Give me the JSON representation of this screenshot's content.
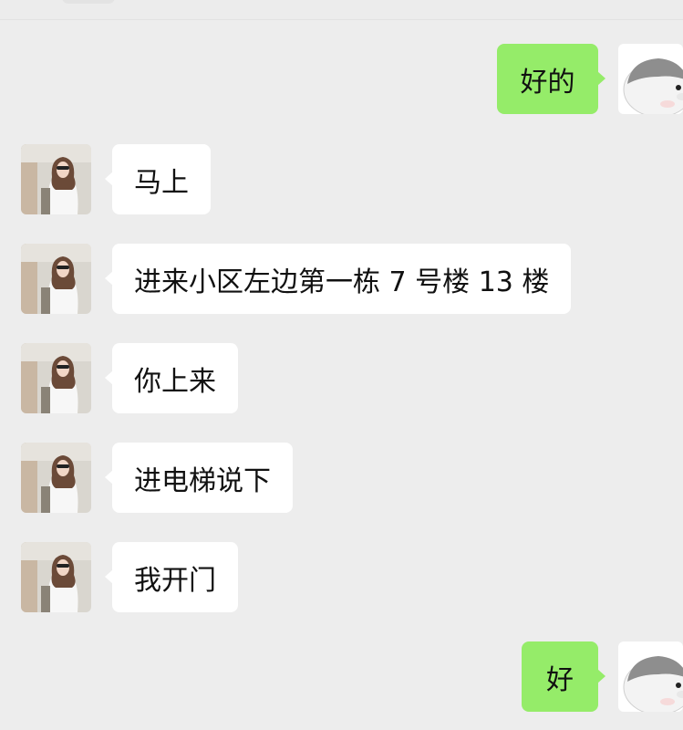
{
  "chat": {
    "messages": [
      {
        "side": "out",
        "text": "好的",
        "avatar": "hamster-icon"
      },
      {
        "side": "in",
        "text": "马上",
        "avatar": "contact-photo"
      },
      {
        "side": "in",
        "text": "进来小区左边第一栋 7 号楼 13 楼",
        "avatar": "contact-photo"
      },
      {
        "side": "in",
        "text": "你上来",
        "avatar": "contact-photo"
      },
      {
        "side": "in",
        "text": "进电梯说下",
        "avatar": "contact-photo"
      },
      {
        "side": "in",
        "text": "我开门",
        "avatar": "contact-photo"
      },
      {
        "side": "out",
        "text": "好",
        "avatar": "hamster-icon"
      }
    ]
  },
  "colors": {
    "background": "#ededed",
    "incoming_bubble": "#ffffff",
    "outgoing_bubble": "#95ec69"
  }
}
